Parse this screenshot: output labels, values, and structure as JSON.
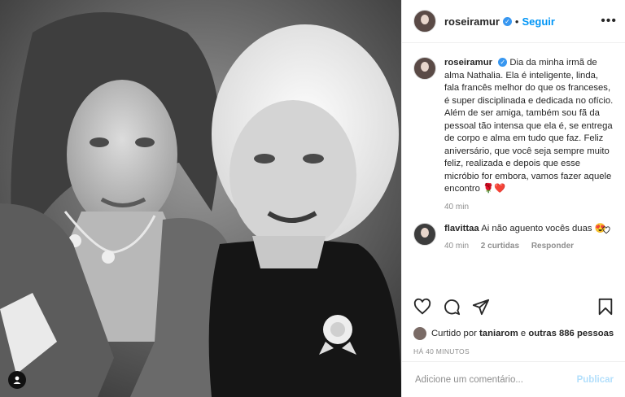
{
  "header": {
    "username": "roseiramur",
    "separator": "•",
    "follow_label": "Seguir",
    "more_icon": "more-horizontal-icon"
  },
  "caption": {
    "username": "roseiramur",
    "text": "Dia da minha irmã de alma Nathalia. Ela é inteligente, linda, fala francês melhor do que os franceses, é super disciplinada e dedicada no ofício. Além de ser amiga, também sou fã da pessoal tão intensa que ela é, se entrega de corpo e alma em tudo que faz. Feliz aniversário, que você seja sempre muito feliz, realizada e depois que esse micróbio for embora, vamos fazer aquele encontro 🌹❤️",
    "time": "40 min"
  },
  "comment": {
    "username": "flavittaa",
    "text": "Ai não aguento vocês duas 😍",
    "time": "40 min",
    "likes": "2 curtidas",
    "reply_label": "Responder"
  },
  "likes": {
    "prefix": "Curtido por",
    "user": "taniarom",
    "middle": "e",
    "others": "outras 886 pessoas"
  },
  "timestamp": "HÁ 40 MINUTOS",
  "add_comment": {
    "placeholder": "Adicione um comentário...",
    "publish_label": "Publicar"
  },
  "colors": {
    "accent": "#0095f6",
    "verified": "#3897f0",
    "publish_disabled": "#b2dffc",
    "muted": "#8e8e8e"
  }
}
